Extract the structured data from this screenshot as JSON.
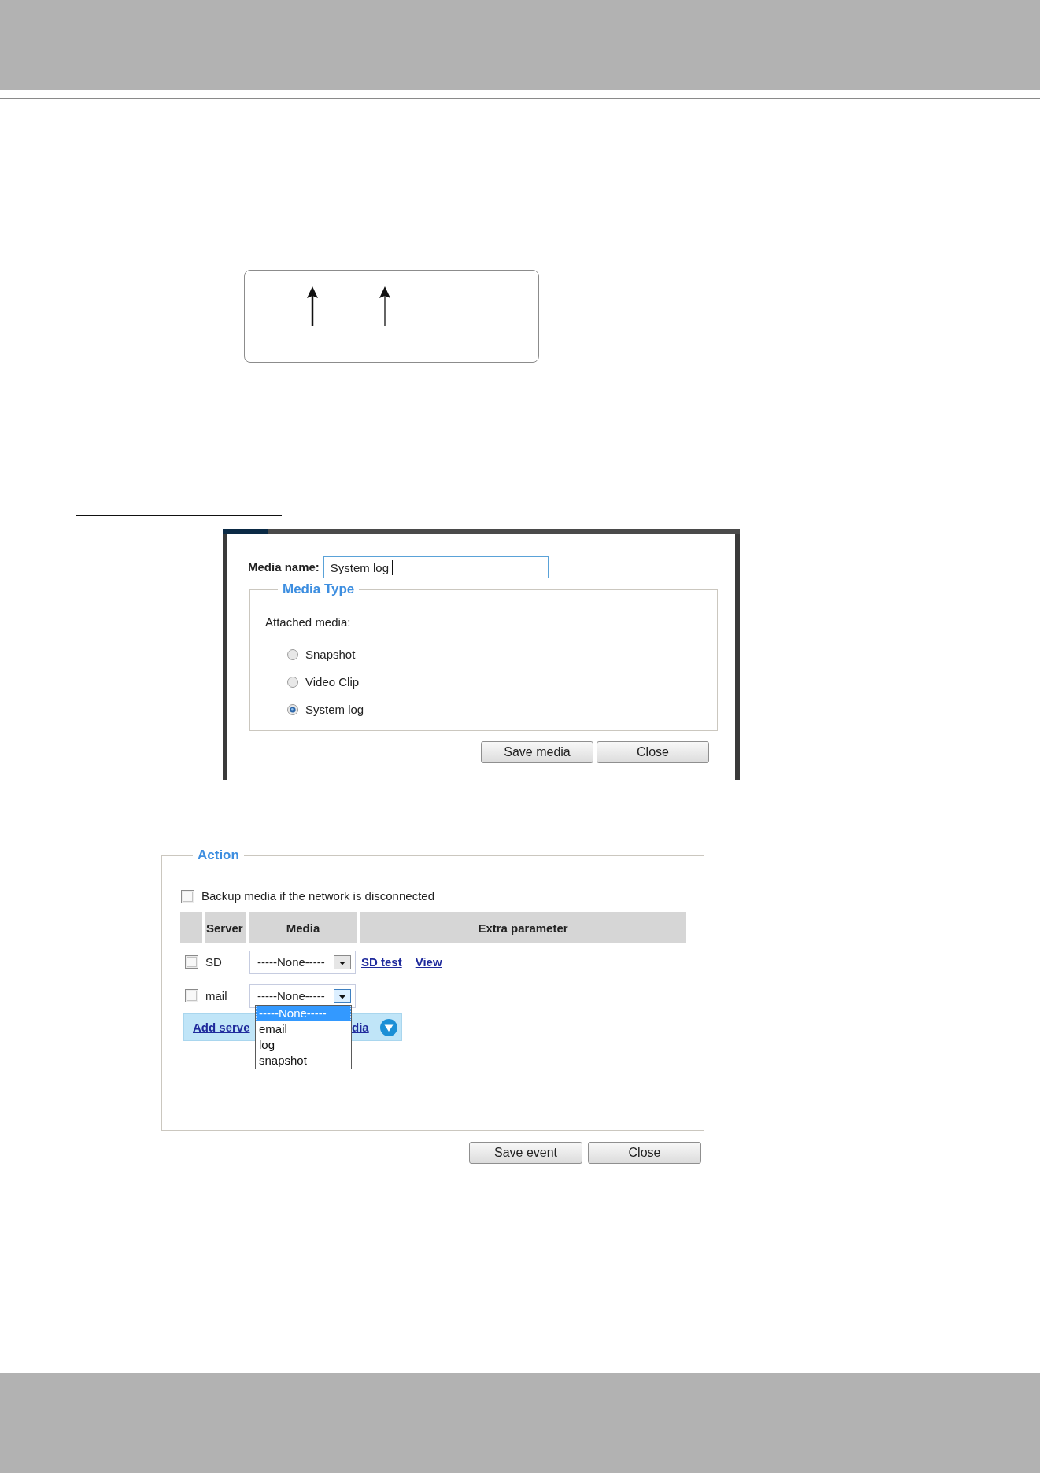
{
  "media_dialog": {
    "media_name": {
      "label": "Media name:",
      "value": "System log",
      "focused": true
    },
    "media_type": {
      "title": "Media Type",
      "prompt": "Attached media:",
      "options": [
        {
          "label": "Snapshot",
          "selected": false
        },
        {
          "label": "Video Clip",
          "selected": false
        },
        {
          "label": "System log",
          "selected": true
        }
      ]
    },
    "buttons": [
      "Save media",
      "Close"
    ]
  },
  "action_panel": {
    "title": "Action",
    "backup": {
      "label": "Backup media if the network is disconnected",
      "checked": false
    },
    "table": {
      "columns": [
        "Server",
        "Media",
        "Extra parameter"
      ],
      "rows": [
        {
          "checked": false,
          "server": "SD",
          "media": {
            "value": "-----None-----",
            "expanded": false
          },
          "links": [
            "SD test",
            "View"
          ]
        },
        {
          "checked": false,
          "server": "mail",
          "media": {
            "value": "-----None-----",
            "expanded": true,
            "options": [
              {
                "label": "-----None-----",
                "selected": true
              },
              {
                "label": "email",
                "selected": false
              },
              {
                "label": "log",
                "selected": false
              },
              {
                "label": "snapshot",
                "selected": false
              }
            ]
          }
        }
      ]
    },
    "add_links": [
      "Add serve",
      "dia"
    ],
    "buttons": [
      "Save event",
      "Close"
    ]
  }
}
